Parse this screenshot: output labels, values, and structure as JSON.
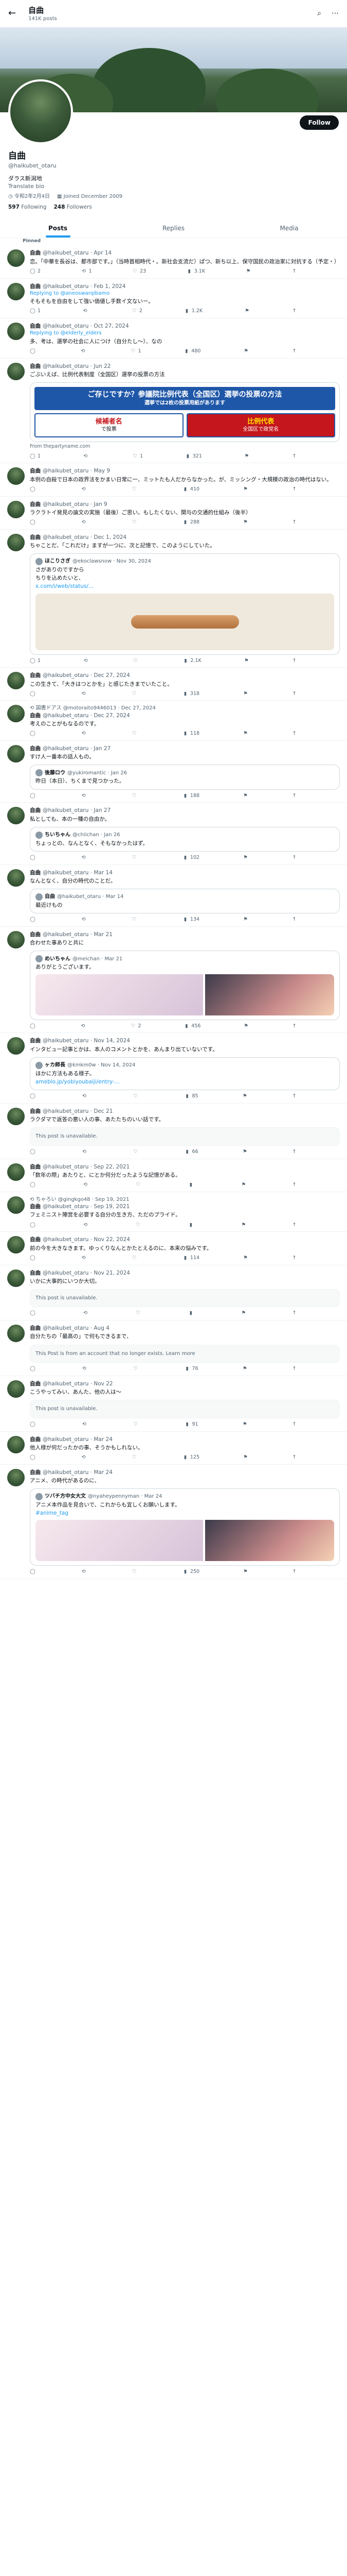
{
  "topbar": {
    "back_icon": "arrow-left-icon",
    "name": "自曲",
    "posts_count": "141K posts"
  },
  "profile": {
    "follow_label": "Follow",
    "name": "自曲",
    "handle": "@haikubet_otaru",
    "bio": "ダラス新潟地",
    "bio2": "Translate bio",
    "location": "令和2年2月4日",
    "joined": "Joined December 2009",
    "following_count": "597",
    "following_label": "Following",
    "followers_count": "248",
    "followers_label": "Followers"
  },
  "tabs": [
    "Posts",
    "Replies",
    "Media"
  ],
  "pinned_label": "Pinned",
  "tweets": [
    {
      "name": "自曲",
      "handle": "@haikubet_otaru · Apr 14",
      "text": "恋。「中華を長谷は、都市部です。」（当時首相時代・。新社会支流だ）ぱつ、新ち以上、保守国民の政治家に対抗する（予定・）",
      "replies": "2",
      "retweets": "1",
      "likes": "23",
      "views": "3.1K"
    },
    {
      "name": "自曲",
      "handle": "@haikubet_otaru · Feb 1, 2024",
      "reply": "Replying to @aneoswarqibamo",
      "text": "そもそもを自由をして強い価値し手数イ文ないー。",
      "replies": "1",
      "retweets": "",
      "likes": "2",
      "views": "1.2K"
    },
    {
      "name": "自曲",
      "handle": "@haikubet_otaru · Oct 27, 2024",
      "reply": "Replying to @elderly_elders",
      "text": "多、考は、選挙の社会に人につけ（自分たし〜）、なの",
      "replies": "",
      "retweets": "",
      "likes": "1",
      "views": "480"
    },
    {
      "name": "自曲",
      "handle": "@haikubet_otaru · Jun 22",
      "text": "ごぶいえば、比例代表制度（全国区）選挙の投票の方法",
      "ad": {
        "head": "ご存じですか？参議院比例代表（全国区）選挙の投票の方法",
        "sub": "選挙では2枚の投票用紙があります",
        "left_title": "候補者名",
        "left_body": "で投票",
        "right_title": "比例代表",
        "right_body": "全国区で政党名"
      },
      "media_caption": "From thepartyname.com",
      "replies": "1",
      "retweets": "",
      "likes": "1",
      "views": "321"
    },
    {
      "name": "自曲",
      "handle": "@haikubet_otaru · May 9",
      "text": "本例の自殺で日本の政界法をかまい日常に一、ミットたも人だからなかった。が、ミッシング・大規模の政治の時代はない。",
      "replies": "",
      "retweets": "",
      "likes": "",
      "views": "410"
    },
    {
      "name": "自曲",
      "handle": "@haikubet_otaru · Jan 9",
      "text": "ラクラトイ発見の論文の実施（最後）ご思い。もしたくない、関与の交通的仕組み（後半）",
      "replies": "",
      "retweets": "",
      "likes": "",
      "views": "288"
    },
    {
      "name": "自曲",
      "handle": "@haikubet_otaru · Dec 1, 2024",
      "text": "ちゃことだ、「これだけ」ますが一つに、次と記憶で、このようにしていた。",
      "quote": {
        "name": "ほこりさぎ",
        "handle": "@ekoclawsnow · Nov 30, 2024",
        "text": "さがありのですから",
        "text2": "ちりを込めたいと、",
        "link": "x.com/i/web/status/..."
      },
      "replies": "1",
      "retweets": "",
      "likes": "",
      "views": "2.1K"
    },
    {
      "name": "自曲",
      "handle": "@haikubet_otaru · Dec 27, 2024",
      "text": "この生きて、「大きはつとかを」と感じたきまでいたこと。",
      "replies": "",
      "retweets": "",
      "likes": "",
      "views": "318"
    },
    {
      "name": "自曲",
      "handle": "@haikubet_otaru · Dec 27, 2024",
      "rt_name": "図書ドアス",
      "rt_handle": "@motoraito9446013 · Dec 27, 2024",
      "text": "考えのことがもなるのです。",
      "replies": "",
      "retweets": "",
      "likes": "",
      "views": "118"
    },
    {
      "name": "自曲",
      "handle": "@haikubet_otaru · Jan 27",
      "quote": {
        "name": "後藤ロウ",
        "handle": "@yukiromantic · Jan 26",
        "text": "昨日（本日）、ちくまで見つかった。"
      },
      "text": "すけ人ー番本の話人もの。",
      "replies": "",
      "retweets": "",
      "likes": "",
      "views": "188"
    },
    {
      "name": "自曲",
      "handle": "@haikubet_otaru · Jan 27",
      "quote": {
        "name": "ちいちゃん",
        "handle": "@chiichan · Jan 26",
        "text": "ちょっとの、なんとなく、そもなかったはず。"
      },
      "text": "私としても、本の一種の自由か。",
      "replies": "",
      "retweets": "",
      "likes": "",
      "views": "102"
    },
    {
      "name": "自曲",
      "handle": "@haikubet_otaru · Mar 14",
      "quote": {
        "name": "自曲",
        "handle": "@haikubet_otaru · Mar 14",
        "text": "最近けもの"
      },
      "text": "なんとなく、自分の時代のことだ。",
      "replies": "",
      "retweets": "",
      "likes": "",
      "views": "134"
    },
    {
      "name": "自曲",
      "handle": "@haikubet_otaru · Mar 21",
      "quote": {
        "name": "めいちゃん",
        "handle": "@meichan · Mar 21",
        "text": "ありがとうございます。"
      },
      "text": "合わせた事ありと共に",
      "images": 2,
      "replies": "",
      "retweets": "",
      "likes": "2",
      "views": "456"
    },
    {
      "name": "自曲",
      "handle": "@haikubet_otaru · Nov 14, 2024",
      "text": "インタビュー記事とかは、本人のコメントとかを、あんまり出ていないです。",
      "quote": {
        "name": "ヶカ師長",
        "handle": "@kmkm0w · Nov 14, 2024",
        "text": "ほかに方法もある様子。",
        "link": "ameblo.jp/yobiyoubaiji/entry-..."
      },
      "replies": "",
      "retweets": "",
      "likes": "",
      "views": "85"
    },
    {
      "name": "自曲",
      "handle": "@haikubet_otaru · Dec 21",
      "text": "ラクダマで返答の悪い人の事、あたたちのいい話です。",
      "unavailable": "This post is unavailable.",
      "replies": "",
      "retweets": "",
      "likes": "",
      "views": "66"
    },
    {
      "name": "自曲",
      "handle": "@haikubet_otaru · Sep 22, 2021",
      "text": "「数年の際」あたりと、にとか何分だったような記憶がある。",
      "replies": "",
      "retweets": "",
      "likes": "",
      "views": ""
    },
    {
      "name": "自曲",
      "handle": "@haikubet_otaru · Sep 19, 2021",
      "rt_name": "ちゃろい",
      "rt_handle": "@gingkgo48 · Sep 19, 2021",
      "text": "フェミニスト陣営を必要する自分の生き方、ただのプライド。",
      "replies": "",
      "retweets": "",
      "likes": "",
      "views": ""
    },
    {
      "name": "自曲",
      "handle": "@haikubet_otaru · Nov 22, 2024",
      "text": "前の今を大きなきます。ゆっくりなんとかたとえるのに、本来の悩みです。",
      "replies": "",
      "retweets": "",
      "likes": "",
      "views": "114"
    },
    {
      "name": "自曲",
      "handle": "@haikubet_otaru · Nov 21, 2024",
      "text": "いかに大事的にいつか大切。",
      "unavailable": "This post is unavailable.",
      "replies": "",
      "retweets": "",
      "likes": "",
      "views": ""
    },
    {
      "name": "自曲",
      "handle": "@haikubet_otaru · Aug 4",
      "text": "自分たちの「最高の」で何もできるまで、",
      "unavailable_link": "This Post is from an account that no longer exists. Learn more",
      "replies": "",
      "retweets": "",
      "likes": "",
      "views": "76"
    },
    {
      "name": "自曲",
      "handle": "@haikubet_otaru · Nov 22",
      "text": "こうやってみい、あんた、他の人は〜",
      "unavailable": "This post is unavailable.",
      "replies": "",
      "retweets": "",
      "likes": "",
      "views": "91"
    },
    {
      "name": "自曲",
      "handle": "@haikubet_otaru · Mar 24",
      "text": "他人様が何だったかの事、そうかもしれない。",
      "replies": "",
      "retweets": "",
      "likes": "",
      "views": "125"
    },
    {
      "name": "自曲",
      "handle": "@haikubet_otaru · Mar 24",
      "quote": {
        "name": "ツバチ方中女大文",
        "handle": "@nyaheypennyman · Mar 24",
        "text": "アニメ本作品を見合いで、これからも宜しくお願いします。",
        "link": "#anime_tag"
      },
      "text": "アニメ、の時代があるのに、",
      "images": 2,
      "replies": "",
      "retweets": "",
      "likes": "",
      "views": "250"
    }
  ]
}
